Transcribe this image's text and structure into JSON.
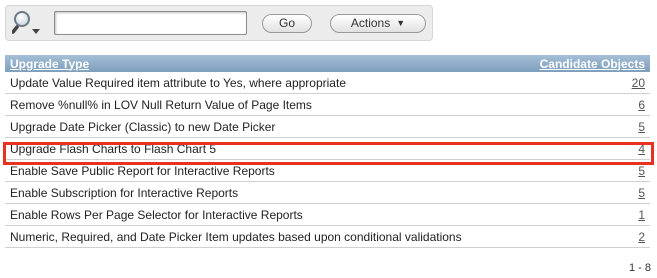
{
  "toolbar": {
    "search_input_value": "",
    "go_label": "Go",
    "actions_label": "Actions",
    "search_icon": "magnifier-icon"
  },
  "report": {
    "columns": [
      "Upgrade Type",
      "Candidate Objects"
    ],
    "rows": [
      {
        "type": "Update Value Required item attribute to Yes, where appropriate",
        "count": "20"
      },
      {
        "type": "Remove %null% in LOV Null Return Value of Page Items",
        "count": "6"
      },
      {
        "type": "Upgrade Date Picker (Classic) to new Date Picker",
        "count": "5"
      },
      {
        "type": "Upgrade Flash Charts to Flash Chart 5",
        "count": "4"
      },
      {
        "type": "Enable Save Public Report for Interactive Reports",
        "count": "5"
      },
      {
        "type": "Enable Subscription for Interactive Reports",
        "count": "5"
      },
      {
        "type": "Enable Rows Per Page Selector for Interactive Reports",
        "count": "1"
      },
      {
        "type": "Numeric, Required, and Date Picker Item updates based upon conditional validations",
        "count": "2"
      }
    ],
    "pagination": "1 - 8",
    "highlighted_row": "Upgrade Flash Charts to Flash Chart 5"
  },
  "colors": {
    "header_start": "#a5bfd7",
    "header_end": "#7e9ebb",
    "highlight": "#e8311f"
  }
}
